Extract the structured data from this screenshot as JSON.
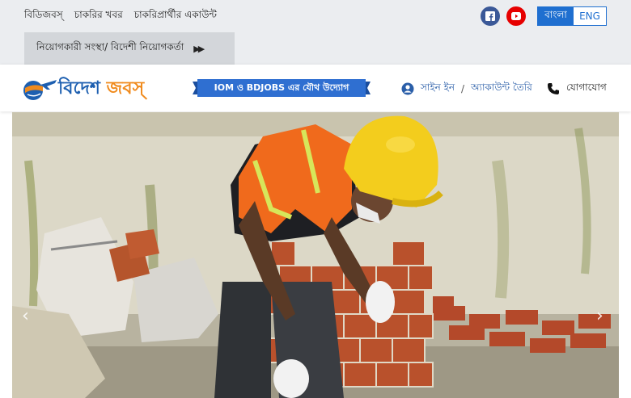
{
  "topbar": {
    "links": [
      "বিডিজবস্",
      "চাকরির খবর",
      "চাকরিপ্রার্থীর একাউন্ট"
    ],
    "social": {
      "facebook_icon": "facebook-icon",
      "youtube_icon": "youtube-icon"
    },
    "lang": {
      "bangla": "বাংলা",
      "english": "ENG"
    },
    "employer_label": "নিয়োগকারী সংস্থা/ বিদেশী নিয়োগকর্তা"
  },
  "header": {
    "logo_part1": "বিদেশ",
    "logo_part2": "জবস্",
    "ribbon": "IOM ও BDJOBS এর যৌথ উদ্যোগ",
    "signin": "সাইন ইন",
    "separator": "/",
    "create_account": "অ্যাকাউন্ট তৈরি",
    "contact": "যোগাযোগ"
  },
  "colors": {
    "brand_blue": "#1f6fd0",
    "logo_orange": "#f08a1c",
    "ribbon_blue": "#2f6fd1"
  },
  "hero": {
    "prev_icon": "chevron-left-icon",
    "next_icon": "chevron-right-icon"
  }
}
